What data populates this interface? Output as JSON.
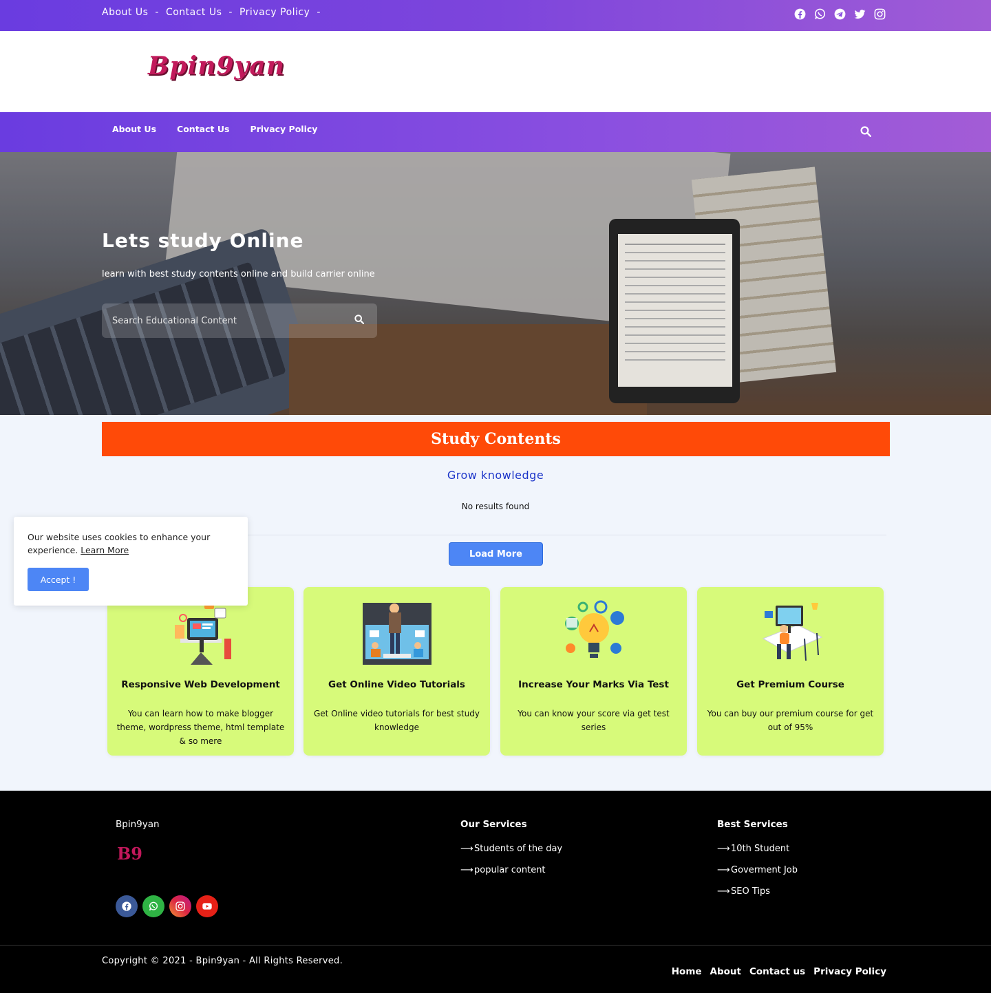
{
  "topbar": {
    "links": [
      "About Us",
      "Contact Us",
      "Privacy Policy"
    ],
    "separator": "-",
    "social_icons": [
      "facebook-icon",
      "whatsapp-icon",
      "telegram-icon",
      "twitter-icon",
      "instagram-icon"
    ]
  },
  "header": {
    "logo": "Bpin9yan"
  },
  "nav": {
    "links": [
      "About Us",
      "Contact Us",
      "Privacy Policy"
    ],
    "search_icon": "search-icon"
  },
  "hero": {
    "title": "Lets study Online",
    "subtitle": "learn with best study contents online and build carrier online",
    "search_placeholder": "Search Educational Content",
    "search_icon": "search-icon"
  },
  "study": {
    "bar_title": "Study Contents",
    "heading": "Grow knowledge",
    "empty_text": "No results found",
    "load_more": "Load More"
  },
  "cookie": {
    "text": "Our website uses cookies to enhance your experience.",
    "link": "Learn More",
    "accept": "Accept !"
  },
  "cards": [
    {
      "title": "Responsive Web Development",
      "text": "You can learn how to make blogger theme, wordpress theme, html template & so mere"
    },
    {
      "title": "Get Online Video Tutorials",
      "text": "Get Online video tutorials for best study knowledge"
    },
    {
      "title": "Increase Your Marks Via Test",
      "text": "You can know your score via get test series"
    },
    {
      "title": "Get Premium Course",
      "text": "You can buy our premium course for get out of 95%"
    }
  ],
  "footer": {
    "brand": "Bpin9yan",
    "logo_text": "B9",
    "social": [
      "facebook-icon",
      "whatsapp-icon",
      "instagram-icon",
      "youtube-icon"
    ],
    "services_title": "Our Services",
    "services": [
      "Students of the day",
      "popular content"
    ],
    "best_title": "Best Services",
    "best": [
      "10th Student",
      "Goverment Job",
      "SEO Tips"
    ],
    "copyright": "Copyright © 2021 - Bpin9yan - All Rights Reserved.",
    "bottom_links": [
      "Home",
      "About",
      "Contact us",
      "Privacy Policy"
    ]
  },
  "colors": {
    "gradient_start": "#6a3ce0",
    "gradient_end": "#a35cd6",
    "study_bar": "#ff4a08",
    "card_bg": "#d7fa7a",
    "button": "#4d86f5",
    "logo": "#c21a5b"
  }
}
